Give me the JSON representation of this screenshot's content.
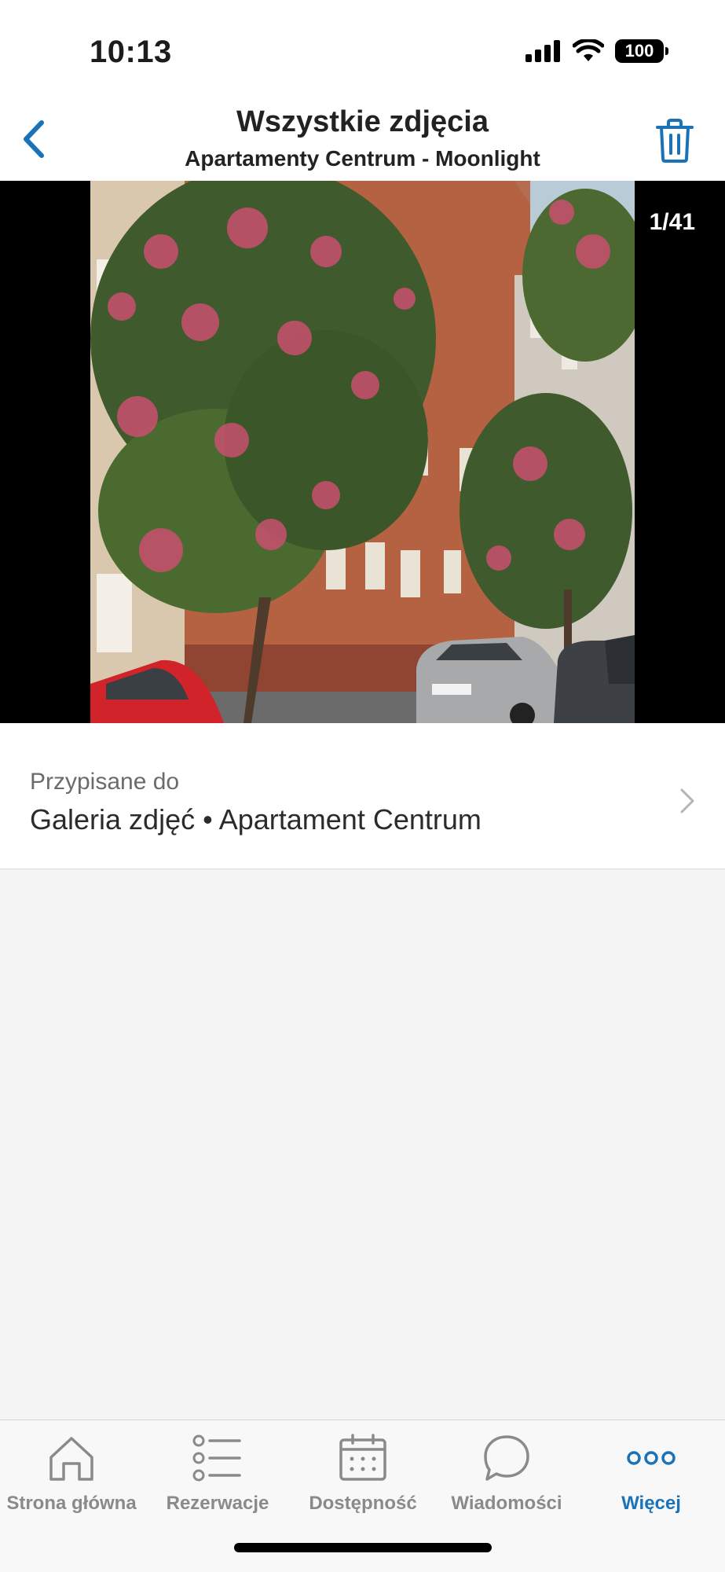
{
  "status_bar": {
    "time": "10:13",
    "battery": "100"
  },
  "header": {
    "title": "Wszystkie zdjęcia",
    "subtitle": "Apartamenty Centrum - Moonlight",
    "back_icon": "chevron-left-icon",
    "delete_icon": "trash-icon"
  },
  "photo": {
    "counter": "1/41",
    "description_icon": "photo-building-with-blossoming-trees"
  },
  "assigned": {
    "label": "Przypisane do",
    "value": "Galeria zdjęć • Apartament Centrum"
  },
  "tabs": [
    {
      "label": "Strona główna",
      "icon": "home-icon",
      "active": false
    },
    {
      "label": "Rezerwacje",
      "icon": "list-icon",
      "active": false
    },
    {
      "label": "Dostępność",
      "icon": "calendar-icon",
      "active": false
    },
    {
      "label": "Wiadomości",
      "icon": "chat-bubble-icon",
      "active": false
    },
    {
      "label": "Więcej",
      "icon": "more-dots-icon",
      "active": true
    }
  ],
  "colors": {
    "accent": "#1a73b8",
    "inactive": "#8a8a8a",
    "photo_background": "#000000",
    "content_background": "#f4f4f4"
  }
}
